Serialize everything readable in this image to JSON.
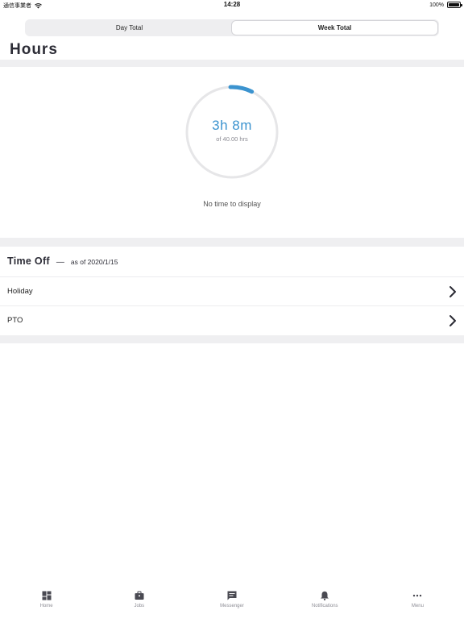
{
  "status_bar": {
    "carrier": "通信事業者",
    "time": "14:28",
    "battery": "100%"
  },
  "segments": {
    "items": [
      {
        "label": "Day Total",
        "active": false
      },
      {
        "label": "Week Total",
        "active": true
      }
    ]
  },
  "page": {
    "title": "Hours"
  },
  "hours": {
    "value": "3h 8m",
    "subtitle": "of 40.00 hrs",
    "progress_fraction": 0.078,
    "accent_color": "#3b93cf",
    "empty_message": "No time to display"
  },
  "time_off": {
    "title": "Time Off",
    "dash": "—",
    "as_of": "as of 2020/1/15",
    "rows": [
      {
        "label": "Holiday",
        "icon": "chevron-right-icon"
      },
      {
        "label": "PTO",
        "icon": "chevron-right-icon"
      }
    ]
  },
  "tab_bar": {
    "items": [
      {
        "label": "Home",
        "icon": "home-grid-icon"
      },
      {
        "label": "Jobs",
        "icon": "briefcase-icon"
      },
      {
        "label": "Messenger",
        "icon": "message-icon"
      },
      {
        "label": "Notifications",
        "icon": "bell-icon"
      },
      {
        "label": "Menu",
        "icon": "more-dots-icon"
      }
    ]
  }
}
